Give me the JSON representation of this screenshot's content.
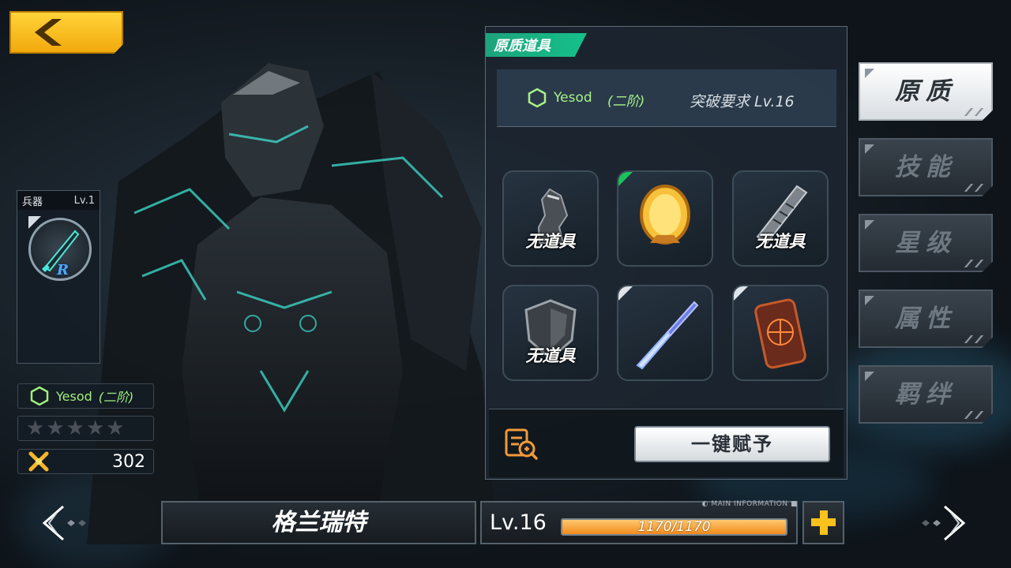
{
  "colors": {
    "accent_gold": "#f9c21c",
    "accent_green": "#15c08a",
    "tier_green": "#a6f288",
    "xp_orange": "#f59a2a"
  },
  "back_button": {
    "icon": "chevron-left-icon"
  },
  "weapon": {
    "label": "兵器",
    "level": "Lv.1",
    "rank": "R"
  },
  "unit_info": {
    "tier_name": "Yesod",
    "tier_stage": "(二阶)",
    "stars_total": 5,
    "stars_filled": 0,
    "power": "302"
  },
  "panel": {
    "tab_title": "原质道具",
    "requirement": {
      "name": "Yesod",
      "stage": "(二阶)",
      "text": "突破要求 Lv.16"
    },
    "slots": [
      {
        "item": "statue",
        "label": "无道具",
        "corner": ""
      },
      {
        "item": "golden-mirror",
        "label": "",
        "corner": "green"
      },
      {
        "item": "ruler",
        "label": "无道具",
        "corner": ""
      },
      {
        "item": "shield",
        "label": "无道具",
        "corner": ""
      },
      {
        "item": "butterfly-knife",
        "label": "",
        "corner": "white"
      },
      {
        "item": "rune-tablet",
        "label": "",
        "corner": "white"
      }
    ],
    "grant_button": "一键赋予"
  },
  "side_tabs": [
    {
      "label": "原质",
      "active": true
    },
    {
      "label": "技能",
      "active": false
    },
    {
      "label": "星级",
      "active": false
    },
    {
      "label": "属性",
      "active": false
    },
    {
      "label": "羁绊",
      "active": false
    }
  ],
  "bottom": {
    "name": "格兰瑞特",
    "level": "Lv.16",
    "main_info": "MAIN INFORMATION",
    "xp_current": 1170,
    "xp_max": 1170,
    "xp_text": "1170/1170"
  }
}
